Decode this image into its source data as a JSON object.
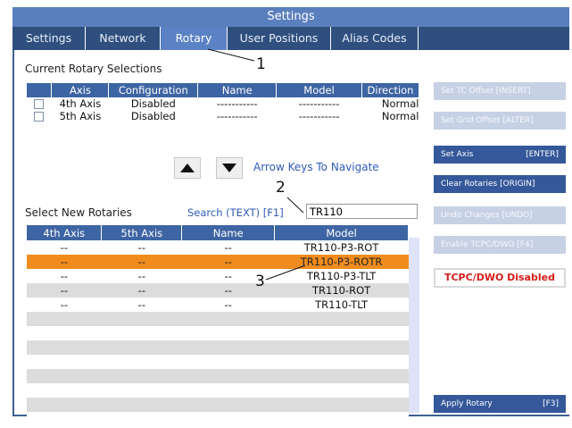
{
  "window": {
    "title": "Settings"
  },
  "tabs": [
    {
      "label": "Settings",
      "active": false
    },
    {
      "label": "Network",
      "active": false
    },
    {
      "label": "Rotary",
      "active": true
    },
    {
      "label": "User Positions",
      "active": false
    },
    {
      "label": "Alias Codes",
      "active": false
    }
  ],
  "current": {
    "section_label": "Current Rotary Selections",
    "headers": [
      "Axis",
      "Configuration",
      "Name",
      "Model",
      "Direction"
    ],
    "rows": [
      {
        "axis": "4th Axis",
        "configuration": "Disabled",
        "name": "-----------",
        "model": "-----------",
        "direction": "Normal"
      },
      {
        "axis": "5th Axis",
        "configuration": "Disabled",
        "name": "-----------",
        "model": "-----------",
        "direction": "Normal"
      }
    ]
  },
  "navigation": {
    "hint": "Arrow Keys To Navigate",
    "up_icon": "triangle-up-icon",
    "down_icon": "triangle-down-icon"
  },
  "new_rotaries": {
    "section_label": "Select New Rotaries",
    "search_label": "Search (TEXT) [F1]",
    "search_value": "TR110",
    "headers": [
      "4th Axis",
      "5th Axis",
      "Name",
      "Model"
    ],
    "rows": [
      {
        "a4": "--",
        "a5": "--",
        "name": "--",
        "model": "TR110-P3-ROT",
        "selected": false
      },
      {
        "a4": "--",
        "a5": "--",
        "name": "--",
        "model": "TR110-P3-ROTR",
        "selected": true
      },
      {
        "a4": "--",
        "a5": "--",
        "name": "--",
        "model": "TR110-P3-TLT",
        "selected": false
      },
      {
        "a4": "--",
        "a5": "--",
        "name": "--",
        "model": "TR110-ROT",
        "selected": false
      },
      {
        "a4": "--",
        "a5": "--",
        "name": "--",
        "model": "TR110-TLT",
        "selected": false
      }
    ],
    "empty_rows": 8
  },
  "sidebar": {
    "buttons": [
      {
        "label": "Set TC Offset [INSERT]",
        "key": "",
        "enabled": false
      },
      {
        "label": "Set Grid Offset [ALTER]",
        "key": "",
        "enabled": false
      },
      {
        "label": "Set Axis",
        "key": "[ENTER]",
        "enabled": true
      },
      {
        "label": "Clear Rotaries [ORIGIN]",
        "key": "",
        "enabled": true
      },
      {
        "label": "Undo Changes [UNDO]",
        "key": "",
        "enabled": false
      },
      {
        "label": "Enable TCPC/DWO [F4]",
        "key": "",
        "enabled": false
      }
    ],
    "status": "TCPC/DWO Disabled",
    "apply": {
      "label": "Apply Rotary",
      "key": "[F3]"
    }
  },
  "callouts": [
    "1",
    "2",
    "3"
  ],
  "colors": {
    "accent": "#3e65a3",
    "selected_row": "#f08c1e",
    "status_red": "#d41c1c"
  }
}
